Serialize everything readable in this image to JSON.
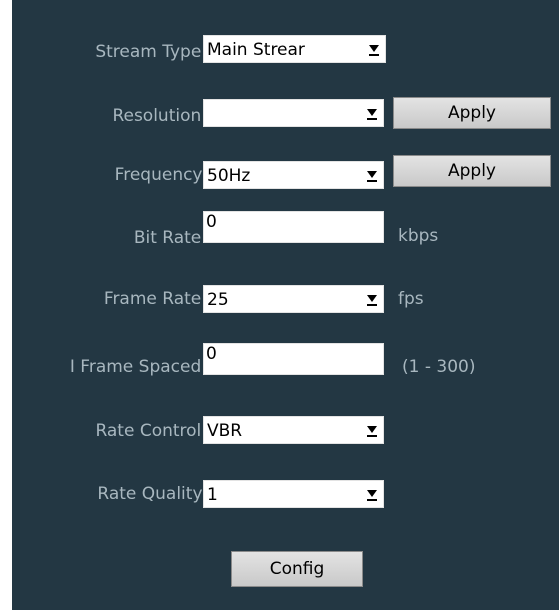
{
  "form": {
    "stream_type": {
      "label": "Stream Type:",
      "value": "Main Strear"
    },
    "resolution": {
      "label": "Resolution:",
      "value": "",
      "apply_label": "Apply"
    },
    "frequency": {
      "label": "Frequency:",
      "value": "50Hz",
      "apply_label": "Apply"
    },
    "bit_rate": {
      "label": "Bit Rate:",
      "value": "0",
      "unit": "kbps"
    },
    "frame_rate": {
      "label": "Frame Rate:",
      "value": "25",
      "unit": "fps"
    },
    "i_frame_spaced": {
      "label": "I Frame Spaced:",
      "value": "0",
      "range": "(1 - 300)"
    },
    "rate_control": {
      "label": "Rate Control:",
      "value": "VBR"
    },
    "rate_quality": {
      "label": "Rate Quality:",
      "value": "1"
    },
    "config_label": "Config"
  },
  "icons": {
    "dropdown": "triangle-down-underline-icon"
  },
  "colors": {
    "panel_background": "#233743",
    "label_text": "#a8b7bf",
    "button_face": "#d6d6d6"
  }
}
